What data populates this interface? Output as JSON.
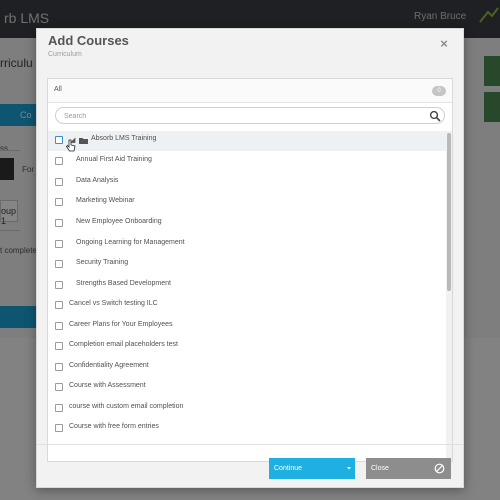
{
  "app": {
    "logo": "rb LMS",
    "user": "Ryan Bruce",
    "page_title": "rriculu",
    "blue_button": "Co",
    "label_ss": "ss",
    "label_for": "For",
    "field_value": "oup 1",
    "label_complete": "t complete"
  },
  "modal": {
    "title": "Add Courses",
    "subtitle": "Curriculum",
    "close_glyph": "×"
  },
  "panel": {
    "all_label": "All",
    "count": "0"
  },
  "search": {
    "placeholder": "Search"
  },
  "items": [
    {
      "label": "Absorb LMS Training"
    },
    {
      "label": "Annual First Aid Training"
    },
    {
      "label": "Data Analysis"
    },
    {
      "label": "Marketing Webinar"
    },
    {
      "label": "New Employee Onboarding"
    },
    {
      "label": "Ongoing Learning for Management"
    },
    {
      "label": "Security Training"
    },
    {
      "label": "Strengths Based Development"
    },
    {
      "label": "Cancel vs Switch testing ILC"
    },
    {
      "label": "Career Plans for Your Employees"
    },
    {
      "label": "Completion email placeholders test"
    },
    {
      "label": "Confidentiality Agreement"
    },
    {
      "label": "Course with Assessment"
    },
    {
      "label": "course with custom email completion"
    },
    {
      "label": "Course with free form entries"
    }
  ],
  "footer": {
    "continue_label": "Continue",
    "close_label": "Close"
  },
  "colors": {
    "continue": "#1fb0e2",
    "close": "#8d8d8d",
    "accent": "#1aa3d6"
  },
  "icons": [
    "folder-icon",
    "caret-down-icon",
    "search-icon",
    "close-icon",
    "ban-icon",
    "dropdown-icon",
    "cursor-icon"
  ]
}
